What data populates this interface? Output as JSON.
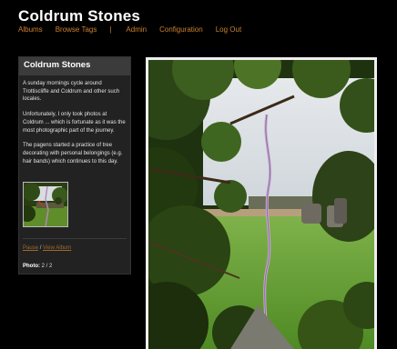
{
  "header": {
    "title": "Coldrum Stones"
  },
  "nav": {
    "albums": "Albums",
    "browse_tags": "Browse Tags",
    "separator": "|",
    "admin": "Admin",
    "configuration": "Configuration",
    "logout": "Log Out"
  },
  "sidebar": {
    "title": "Coldrum Stones",
    "paragraphs": [
      "A sunday mornings cycle around Trottiscliffe and Coldrum and other such locales.",
      "Unfortunately, I only took photos at Coldrum ... which is fortunate as it was the most photographic part of the journey.",
      "The pagens started a practice of tree decorating with personal belongings (e.g. hair bands) which continues to this day."
    ],
    "pause_label": "Pause",
    "controls_separator": "/",
    "view_album_label": "View Album",
    "photo_label": "Photo:",
    "photo_count": "2 / 2"
  },
  "colors": {
    "background": "#000000",
    "link": "#c9822f",
    "panel": "#222222",
    "panel_header": "#3b3b3b"
  },
  "icons": {
    "thumbnail": "photo-thumbnail",
    "main": "main-photo"
  }
}
